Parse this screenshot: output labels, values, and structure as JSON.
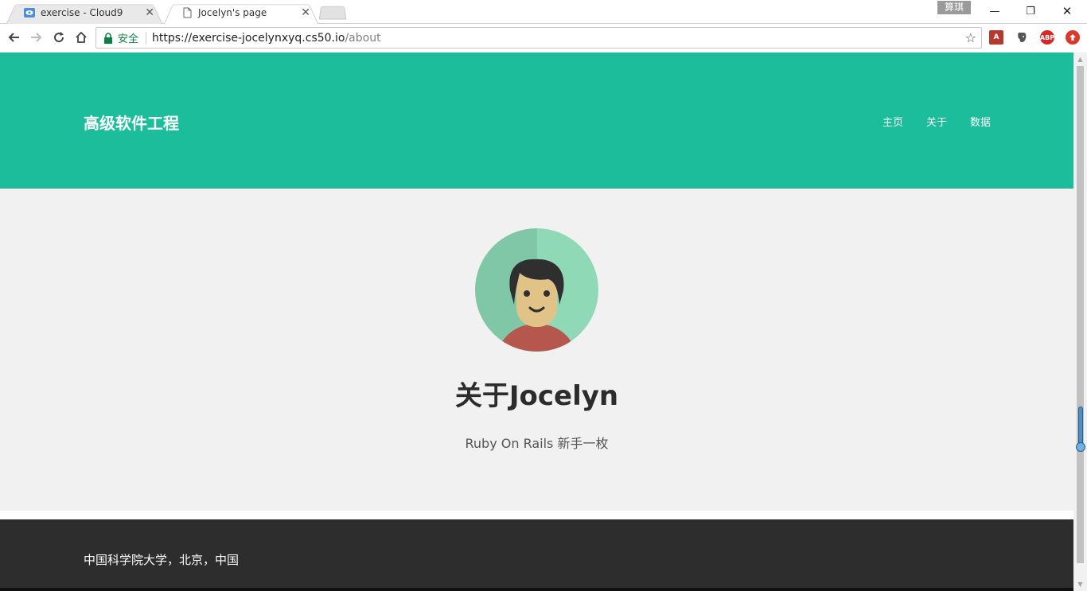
{
  "browser": {
    "tabs": [
      {
        "title": "exercise - Cloud9",
        "active": false
      },
      {
        "title": "Jocelyn's page",
        "active": true
      }
    ],
    "user_badge": "算琪",
    "address": {
      "secure_label": "安全",
      "url_host": "https://exercise-jocelynxyq.cs50.io",
      "url_path": "/about"
    },
    "icons": [
      "back-icon",
      "forward-icon",
      "reload-icon",
      "home-icon",
      "lock-icon",
      "star-icon",
      "pdf-extension-icon",
      "evernote-icon",
      "adblock-icon",
      "upload-icon"
    ],
    "extensions": {
      "adblock_label": "ABP",
      "pdf_label": "A"
    },
    "window_buttons": {
      "minimize": "—",
      "restore": "❐",
      "close": "✕"
    }
  },
  "site": {
    "brand": "高级软件工程",
    "nav": [
      "主页",
      "关于",
      "数据"
    ],
    "header_color": "#1cbd9b"
  },
  "about": {
    "title": "关于Jocelyn",
    "subtitle": "Ruby On Rails 新手一枚"
  },
  "footer": {
    "text": "中国科学院大学，北京，中国"
  }
}
